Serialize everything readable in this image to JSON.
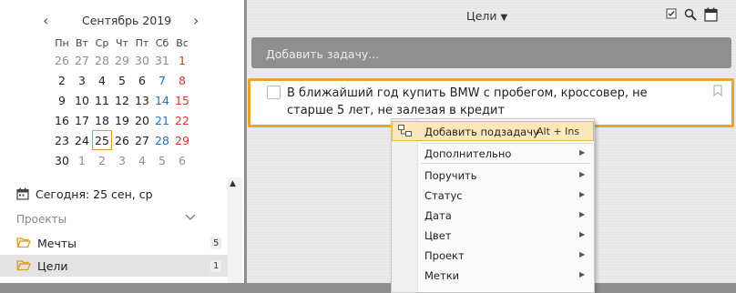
{
  "calendar": {
    "month_title": "Сентябрь 2019",
    "weekdays": [
      "Пн",
      "Вт",
      "Ср",
      "Чт",
      "Пт",
      "Сб",
      "Вс"
    ],
    "weeks": [
      [
        "26",
        "27",
        "28",
        "29",
        "30",
        "31",
        "1"
      ],
      [
        "2",
        "3",
        "4",
        "5",
        "6",
        "7",
        "8"
      ],
      [
        "9",
        "10",
        "11",
        "12",
        "13",
        "14",
        "15"
      ],
      [
        "16",
        "17",
        "18",
        "19",
        "20",
        "21",
        "22"
      ],
      [
        "23",
        "24",
        "25",
        "26",
        "27",
        "28",
        "29"
      ],
      [
        "30",
        "1",
        "2",
        "3",
        "4",
        "5",
        "6"
      ]
    ]
  },
  "sidebar": {
    "today_label": "Сегодня: 25 сен, ср",
    "projects_header": "Проекты",
    "projects": [
      {
        "name": "Мечты",
        "count": "5"
      },
      {
        "name": "Цели",
        "count": "1"
      }
    ]
  },
  "main": {
    "title": "Цели",
    "add_task_placeholder": "Добавить задачу...",
    "task_text": "В ближайший год купить BMW с пробегом, кроссовер, не старше 5 лет, не залезая в кредит"
  },
  "context_menu": {
    "add_subtask": "Добавить подзадачу",
    "add_subtask_shortcut": "Alt + Ins",
    "extra": "Дополнительно",
    "assign": "Поручить",
    "status": "Статус",
    "date": "Дата",
    "color": "Цвет",
    "project": "Проект",
    "tags": "Метки"
  },
  "colors": {
    "accent_orange": "#f0a12d",
    "weekend_saturday": "#2a72b5",
    "weekend_sunday": "#d2392f",
    "menu_highlight": "#fbe8b8"
  }
}
